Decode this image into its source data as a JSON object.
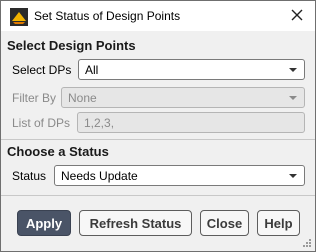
{
  "window": {
    "title": "Set Status of Design Points",
    "icon": "fluent-app-icon",
    "close_icon": "close-icon"
  },
  "select_section": {
    "heading": "Select Design Points",
    "select_dps_label": "Select DPs",
    "select_dps_value": "All",
    "filter_by_label": "Filter By",
    "filter_by_value": "None",
    "list_of_dps_label": "List of DPs",
    "list_of_dps_value": "1,2,3,"
  },
  "status_section": {
    "heading": "Choose a Status",
    "status_label": "Status",
    "status_value": "Needs Update"
  },
  "buttons": {
    "apply": "Apply",
    "refresh": "Refresh Status",
    "close": "Close",
    "help": "Help"
  },
  "colors": {
    "primary_button": "#4a5467",
    "dialog_background": "#f0f0f0"
  }
}
